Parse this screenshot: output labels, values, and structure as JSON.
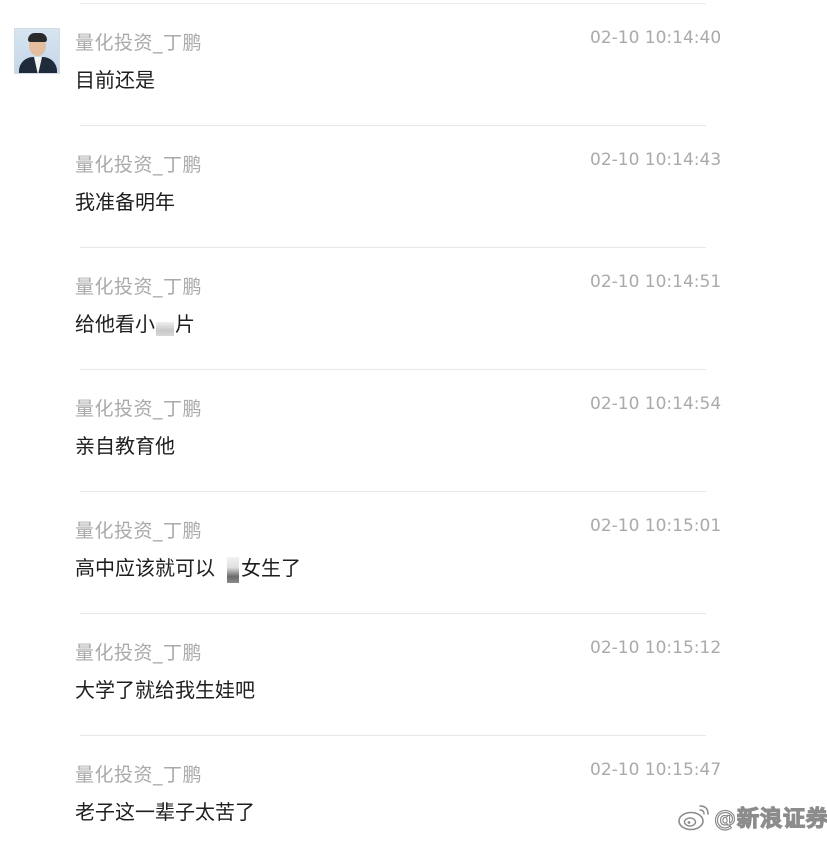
{
  "messages": [
    {
      "sender": "量化投资_丁鹏",
      "time": "02-10 10:14:40",
      "text": "目前还是"
    },
    {
      "sender": "量化投资_丁鹏",
      "time": "02-10 10:14:43",
      "text": "我准备明年"
    },
    {
      "sender": "量化投资_丁鹏",
      "time": "02-10 10:14:51",
      "text_before": "给他看小",
      "text_after": "片"
    },
    {
      "sender": "量化投资_丁鹏",
      "time": "02-10 10:14:54",
      "text": "亲自教育他"
    },
    {
      "sender": "量化投资_丁鹏",
      "time": "02-10 10:15:01",
      "text_before": "高中应该就可以",
      "text_after": "女生了"
    },
    {
      "sender": "量化投资_丁鹏",
      "time": "02-10 10:15:12",
      "text": "大学了就给我生娃吧"
    },
    {
      "sender": "量化投资_丁鹏",
      "time": "02-10 10:15:47",
      "text": "老子这一辈子太苦了"
    }
  ],
  "watermark": {
    "logo_icon": "weibo-logo-icon",
    "text": "@新浪证券"
  },
  "colors": {
    "meta_text": "#aaaaaa",
    "message_text": "#1e1e1e",
    "divider": "#e8e8e8",
    "background": "#ffffff"
  }
}
